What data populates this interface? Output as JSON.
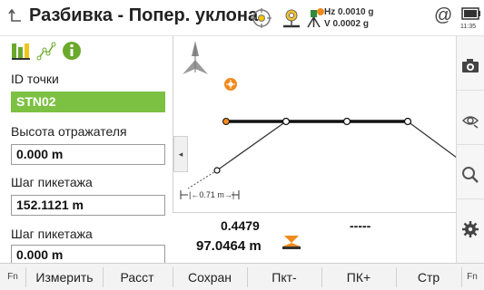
{
  "titlebar": {
    "title": "Разбивка - Попер. уклона",
    "hz_line": "Hz 0.0010 g",
    "v_line": "V  0.0002 g",
    "at_symbol": "@",
    "battery_time": "11:35",
    "icons": [
      "back-icon",
      "target-crosshair-icon",
      "prism-person-icon",
      "instrument-tripod-icon",
      "at-icon",
      "battery-icon"
    ]
  },
  "left_panel": {
    "tool_icons": [
      "bars-icon",
      "polyline-icon",
      "info-icon"
    ],
    "fields": [
      {
        "label": "ID точки",
        "value": "STN02",
        "selected": true
      },
      {
        "label": "Высота отражателя",
        "value": "0.000 m",
        "selected": false
      },
      {
        "label": "Шаг пикетажа",
        "value": "152.1121 m",
        "selected": false
      },
      {
        "label": "Шаг пикетажа",
        "value": "0.000 m",
        "selected": false
      }
    ]
  },
  "graphic": {
    "scale_label": "0.71 m",
    "collapse_symbol": "◂"
  },
  "readouts": {
    "value_1": "0.4479",
    "value_2": "-----",
    "value_3": "97.0464 m"
  },
  "right_toolbar": [
    "camera-icon",
    "eye-scan-icon",
    "search-icon",
    "settings-gear-icon"
  ],
  "bottom_bar": {
    "fn_left": "Fn",
    "fn_right": "Fn",
    "keys": [
      "Измерить",
      "Расст",
      "Сохран",
      "Пкт-",
      "ПК+",
      "Стр"
    ]
  },
  "colors": {
    "accent_green": "#7cc142",
    "orange": "#f08a1c",
    "line_black": "#111111"
  }
}
